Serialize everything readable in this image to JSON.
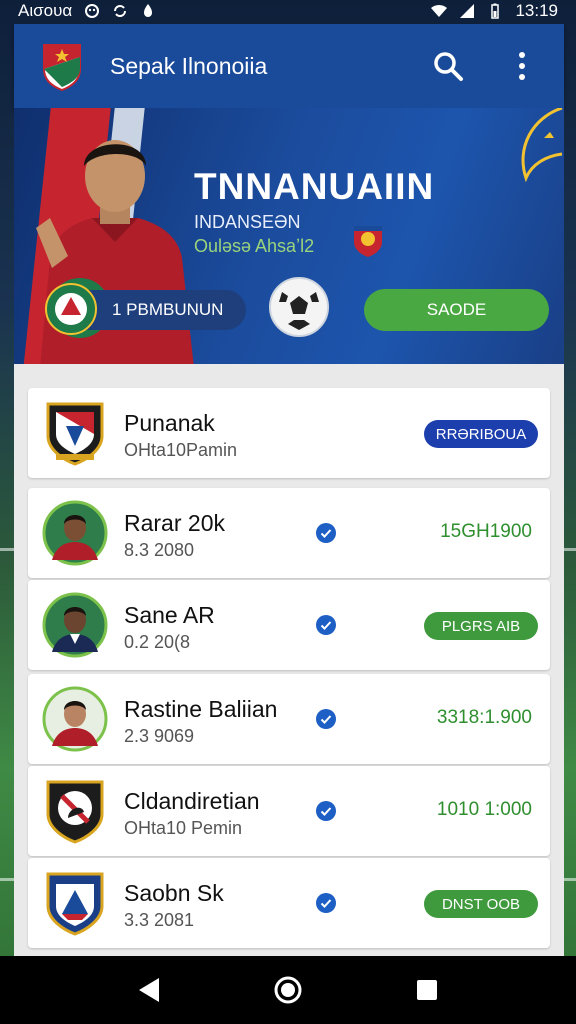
{
  "status_bar": {
    "left_text": "Aισουα",
    "time": "13:19"
  },
  "app_bar": {
    "title": "Sepak Ilnonoiia",
    "icons": [
      "team-logo-icon",
      "search-icon",
      "more-vert-icon"
    ]
  },
  "hero": {
    "title": "TNNANUAIIN",
    "subtitle_1": "INDANSEƏN",
    "subtitle_2": "Ouləsə Ahsaʼl2",
    "pill_label": "1 PBMBUNUN",
    "button_label": "SAODE"
  },
  "list": [
    {
      "name": "Punanak",
      "sub": "OHta10Pamin",
      "verified": false,
      "tag": "RRƏRIBOUA",
      "tag_style": "blue-badge",
      "avatar": "club-crest-icon"
    },
    {
      "name": "Rarar 20k",
      "sub": "8.3 2080",
      "verified": true,
      "tag": "15GH1900",
      "tag_style": "green-text",
      "avatar": "player-avatar"
    },
    {
      "name": "Sane AR",
      "sub": "0.2 20(8",
      "verified": true,
      "tag": "PLGRS AIB",
      "tag_style": "green-badge",
      "avatar": "player-avatar"
    },
    {
      "name": "Rastine Baliian",
      "sub": "2.3 9069",
      "verified": true,
      "tag": "3318:1.900",
      "tag_style": "green-text",
      "avatar": "player-avatar"
    },
    {
      "name": "Cldandiretian",
      "sub": "OHta10 Pemin",
      "verified": true,
      "tag": "1010 1:000",
      "tag_style": "green-text",
      "avatar": "club-crest-icon"
    },
    {
      "name": "Saobn Sk",
      "sub": "3.3 2081",
      "verified": true,
      "tag": "DNST OOB",
      "tag_style": "green-badge",
      "avatar": "club-crest-icon"
    }
  ],
  "colors": {
    "primary": "#1a4a9a",
    "accent_green": "#4aa843",
    "accent_red": "#c6252f",
    "badge_blue": "#1d3fae",
    "verify_blue": "#1d5fc4"
  },
  "nav": [
    "back-icon",
    "home-icon",
    "recents-icon"
  ]
}
